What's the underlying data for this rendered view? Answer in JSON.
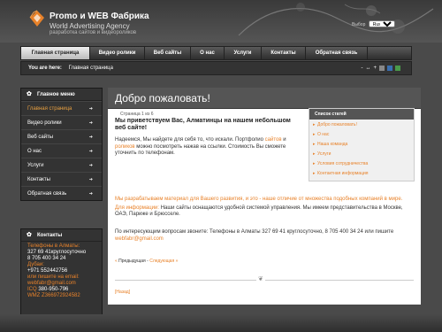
{
  "header": {
    "brand_title": "Promo и WEB Фабрика",
    "brand_subtitle": "World Advertising Agency",
    "brand_tagline": "разработка сайтов и видеороликов",
    "language_label": "Выбор",
    "language_value": "Russian"
  },
  "nav": {
    "items": [
      {
        "label": "Главная страница",
        "width": 78
      },
      {
        "label": "Видео ролики",
        "width": 62
      },
      {
        "label": "Веб сайты",
        "width": 52
      },
      {
        "label": "О нас",
        "width": 38
      },
      {
        "label": "Услуги",
        "width": 42
      },
      {
        "label": "Контакты",
        "width": 50
      },
      {
        "label": "Обратная связь",
        "width": 70
      }
    ]
  },
  "breadcrumb": {
    "label": "You are here:",
    "current": "Главная страница",
    "font_decrease": "-",
    "font_increase": "+"
  },
  "colors": {
    "accent": "#e8822a",
    "square_1": "#888888",
    "square_2": "#3a6fb0",
    "square_3": "#4a9a4a"
  },
  "sidebar": {
    "menu_title": "Главное меню",
    "menu_items": [
      "Главная страница",
      "Видео ролики",
      "Веб сайты",
      "О нас",
      "Услуги",
      "Контакты",
      "Обратная связь"
    ],
    "contacts_title": "Контакты",
    "contacts": {
      "almaty_label": "Телефоны в Алматы:",
      "almaty_phone_1": "327 69 41круглосуточно",
      "almaty_phone_2": "8 705 400 34 24",
      "dubai_label": "Дубаи:",
      "dubai_phone": "+971 552442756",
      "email_label": "или пишите на email:",
      "email": "webfabr@gmail.com",
      "icq_label": "ICQ",
      "icq": "380-950-796",
      "wmz": "WMZ Z366972924582"
    }
  },
  "main": {
    "title": "Добро пожаловать!",
    "page_count": "Страница 1 из 6",
    "welcome": "Мы приветствуем Вас, Алматинцы на нашем небольшом веб сайте!",
    "intro_1": "Надеемся, Мы найдете для себя то, что искали. Портфолио",
    "intro_link_1": "сайтов",
    "intro_2": "и",
    "intro_link_2": "роликов",
    "intro_3": "можно посмотреть нажав на ссылки. Стоимость Вы сможете уточнить по телефонам.",
    "para2_highlight": "Мы разрабатываем материал для Вашего развития, и это - наше отличие от множества подобных компаний в мире.",
    "para2_label": "Для информации:",
    "para2_text": "Наши сайты оснащаются удобной системой управления. Мы имеем представительства в Москве, ОАЭ, Париже и Брюсселе.",
    "para3_text": "По интересующим вопросам звоните: Телефоны в Алматы   327 69 41 круглосуточно, 8 705 400 34 24 или пишите",
    "para3_email": "webfabr@gmail.com",
    "prev_label": "Предыдущая",
    "next_label": "Следующая",
    "back_label": "[Назад]"
  },
  "articles": {
    "title": "Список статей",
    "items": [
      "Добро пожаловать!",
      "О нас",
      "Наша команда",
      "Услуги",
      "Условия сотрудничества",
      "Контактная информация"
    ]
  }
}
